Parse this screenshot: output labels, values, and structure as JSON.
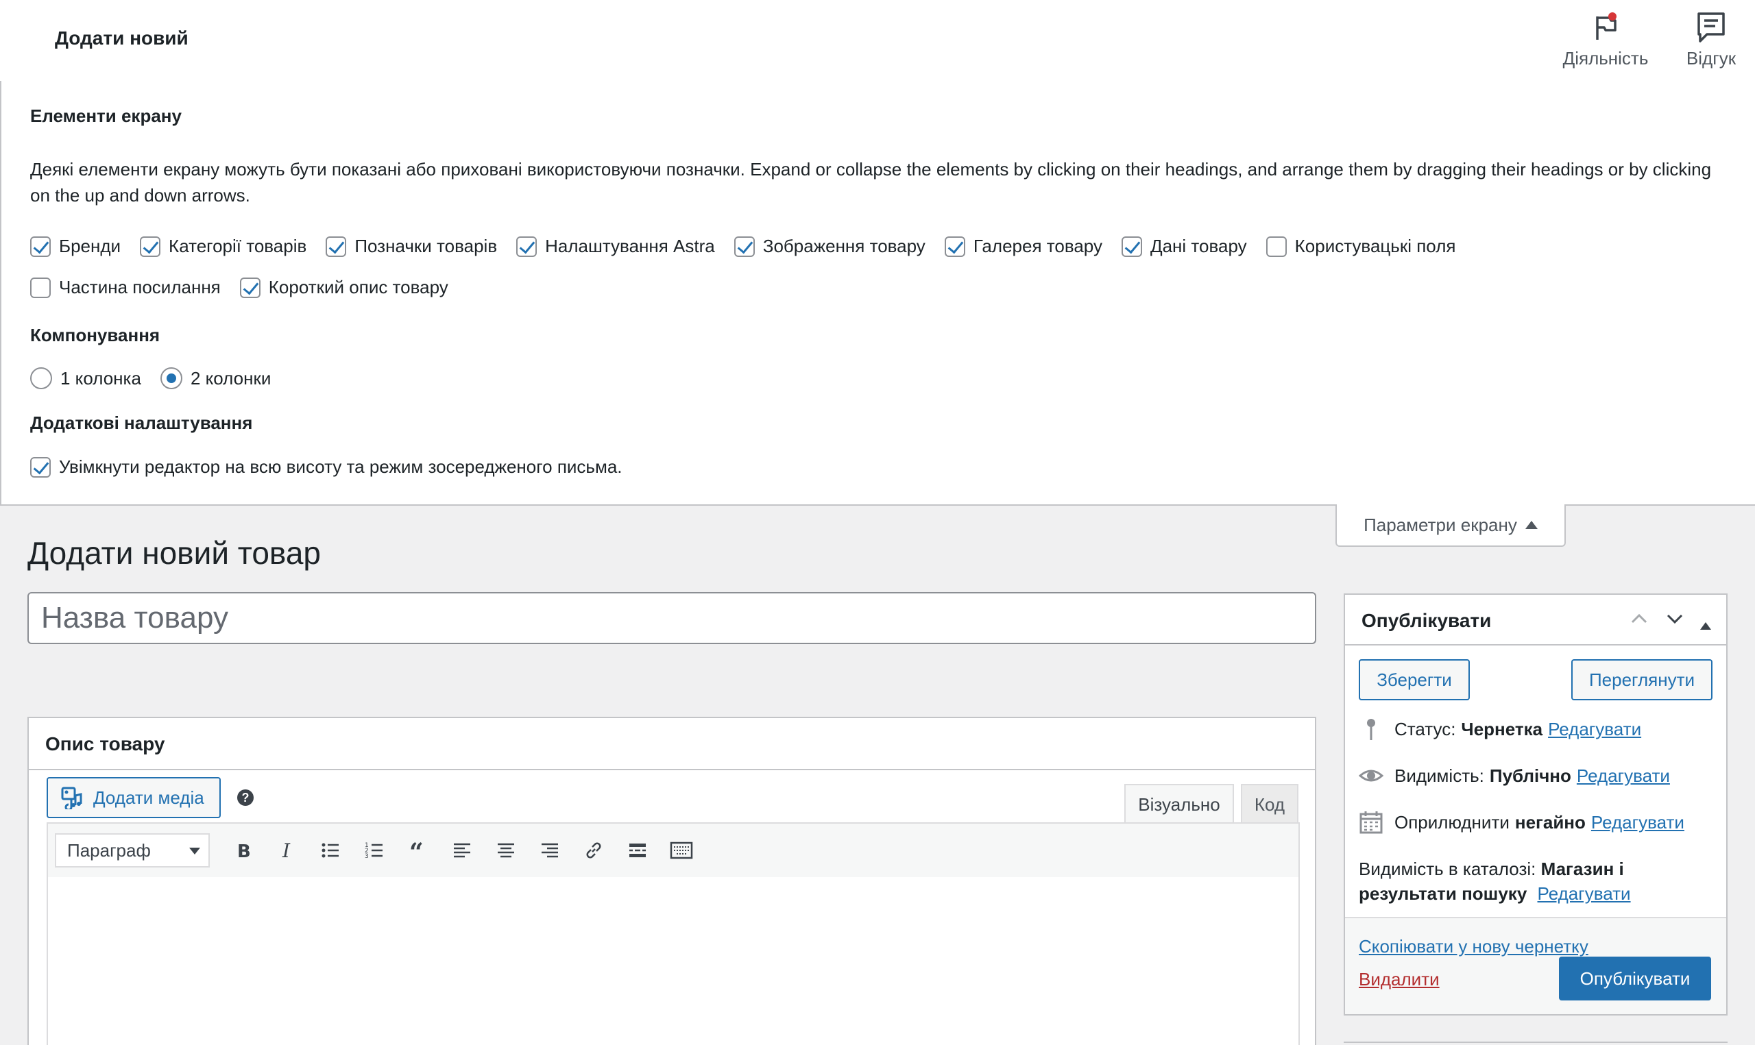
{
  "header": {
    "page_name": "Додати новий",
    "activity_label": "Діяльність",
    "feedback_label": "Відгук"
  },
  "screen_options": {
    "elements_heading": "Елементи екрану",
    "description": "Деякі елементи екрану можуть бути показані або приховані використовуючи позначки. Expand or collapse the elements by clicking on their headings, and arrange them by dragging their headings or by clicking on the up and down arrows.",
    "checkboxes_row1": [
      {
        "label": "Бренди",
        "checked": true
      },
      {
        "label": "Категорії товарів",
        "checked": true
      },
      {
        "label": "Позначки товарів",
        "checked": true
      },
      {
        "label": "Налаштування Astra",
        "checked": true
      },
      {
        "label": "Зображення товару",
        "checked": true
      },
      {
        "label": "Галерея товару",
        "checked": true
      },
      {
        "label": "Дані товару",
        "checked": true
      },
      {
        "label": "Користувацькі поля",
        "checked": false
      }
    ],
    "checkboxes_row2": [
      {
        "label": "Частина посилання",
        "checked": false
      },
      {
        "label": "Короткий опис товару",
        "checked": true
      }
    ],
    "layout_heading": "Компонування",
    "layout_options": [
      {
        "label": "1 колонка",
        "selected": false
      },
      {
        "label": "2 колонки",
        "selected": true
      }
    ],
    "additional_heading": "Додаткові налаштування",
    "fullheight_label": "Увімкнути редактор на всю висоту та режим зосередженого письма.",
    "fullheight_checked": true,
    "tab_label": "Параметри екрану"
  },
  "main": {
    "title": "Додати новий товар",
    "title_placeholder": "Назва товару",
    "title_value": ""
  },
  "description_box": {
    "heading": "Опис товару",
    "add_media_label": "Додати медіа",
    "help_glyph": "?",
    "tab_visual": "Візуально",
    "tab_code": "Код",
    "format_select": "Параграф",
    "toolbar_icons": [
      "bold-icon",
      "italic-icon",
      "bullet-list-icon",
      "numbered-list-icon",
      "blockquote-icon",
      "align-left-icon",
      "align-center-icon",
      "align-right-icon",
      "link-icon",
      "read-more-icon",
      "toolbar-toggle-icon"
    ]
  },
  "publish_box": {
    "heading": "Опублікувати",
    "save_label": "Зберегти",
    "preview_label": "Переглянути",
    "status_label": "Статус:",
    "status_value": "Чернетка",
    "visibility_label": "Видимість:",
    "visibility_value": "Публічно",
    "publish_time_label": "Оприлюднити",
    "publish_time_value": "негайно",
    "edit_link": "Редагувати",
    "catalog_label": "Видимість в каталозі:",
    "catalog_value": "Магазин і результати пошуку",
    "copy_link": "Скопіювати у нову чернетку",
    "delete_link": "Видалити",
    "publish_button": "Опублікувати"
  },
  "colors": {
    "accent": "#2271b1",
    "danger": "#b32d2e",
    "badge": "#d63638",
    "background": "#f0f0f1"
  }
}
